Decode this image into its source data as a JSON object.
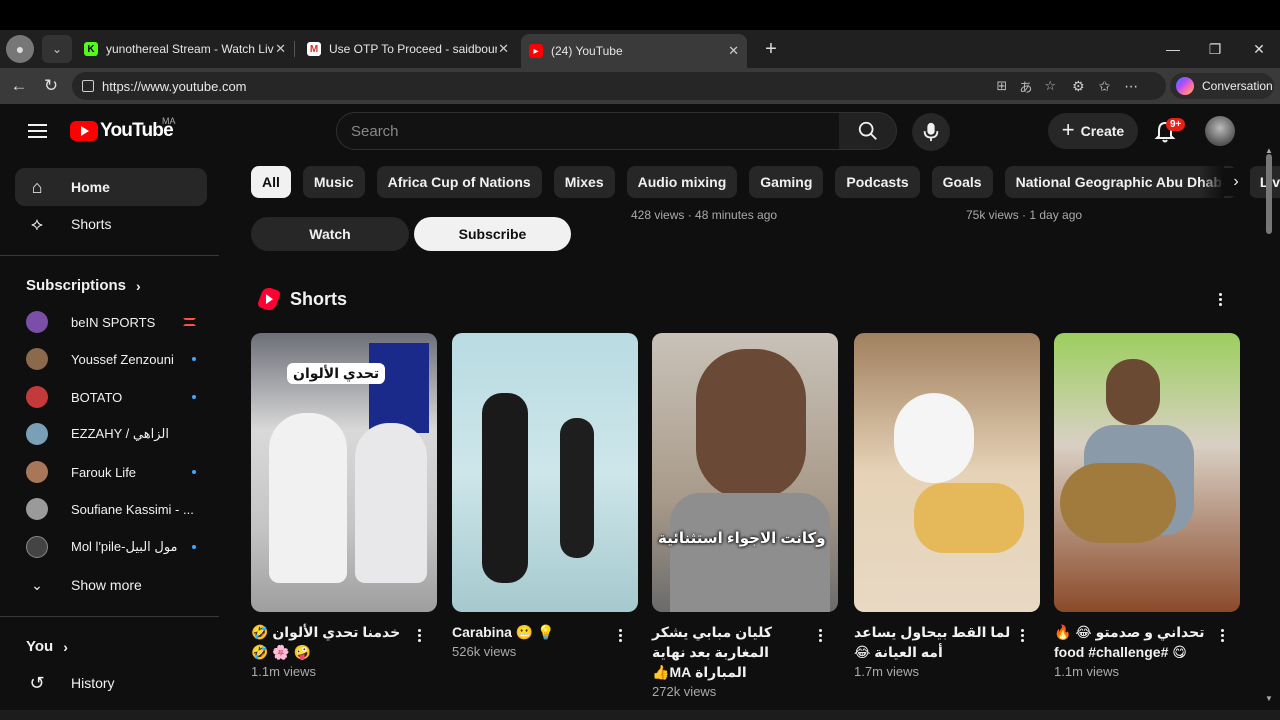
{
  "browser": {
    "tabs": [
      {
        "title": "yunothereal Stream - Watch Live o",
        "favicon": "K"
      },
      {
        "title": "Use OTP To Proceed - saidbourziq",
        "favicon": "M"
      },
      {
        "title": "(24) YouTube",
        "favicon": "yt"
      }
    ],
    "active_tab": 2,
    "url": "https://www.youtube.com",
    "conversation_label": "Conversation"
  },
  "header": {
    "logo_text": "YouTube",
    "country_code": "MA",
    "search_placeholder": "Search",
    "create_label": "Create",
    "notification_count": "9+"
  },
  "sidebar": {
    "main": [
      {
        "label": "Home",
        "icon": "home-icon"
      },
      {
        "label": "Shorts",
        "icon": "shorts-icon"
      }
    ],
    "subscriptions_title": "Subscriptions",
    "subscriptions": [
      {
        "name": "beIN SPORTS",
        "status": "live",
        "color": "#7b4fa8"
      },
      {
        "name": "Youssef Zenzouni",
        "status": "new",
        "color": "#8a6a4a"
      },
      {
        "name": "BOTATO",
        "status": "new",
        "color": "#c43a3a"
      },
      {
        "name": "EZZAHY / الزاهي",
        "status": "",
        "color": "#7aa0b8"
      },
      {
        "name": "Farouk Life",
        "status": "new",
        "color": "#a8775a"
      },
      {
        "name": "Soufiane Kassimi - ...",
        "status": "",
        "color": "#9a9a9a"
      },
      {
        "name": "Mol l'pile-مول البيل",
        "status": "new",
        "color": "#444444"
      }
    ],
    "show_more": "Show more",
    "you_title": "You",
    "history": "History"
  },
  "chips": [
    "All",
    "Music",
    "Africa Cup of Nations",
    "Mixes",
    "Audio mixing",
    "Gaming",
    "Podcasts",
    "Goals",
    "National Geographic Abu Dhabi",
    "Live"
  ],
  "above": {
    "meta1": "428 views · 48 minutes ago",
    "meta2": "75k views · 1 day ago",
    "watch_label": "Watch",
    "subscribe_label": "Subscribe"
  },
  "shorts": {
    "title": "Shorts",
    "items": [
      {
        "title": "خدمنا تحدي الألوان 🤣 🤪 🌸 🤣",
        "views": "1.1m views",
        "overlay": "تحدي الألوان"
      },
      {
        "title": "Carabina 😬 💡",
        "views": "526k views",
        "overlay": ""
      },
      {
        "title": "كليان مبابي يشكر المغاربة بعد نهاية المباراة MA👍",
        "views": "272k views",
        "overlay": "وكانت الاجواء استثنائية"
      },
      {
        "title": "لما القط بيحاول يساعد أمه العيانة 😂",
        "views": "1.7m views",
        "overlay": ""
      },
      {
        "title": "تحداني و صدمتو 😂 🔥 😋 #food #challenge",
        "views": "1.1m views",
        "overlay": ""
      }
    ]
  }
}
